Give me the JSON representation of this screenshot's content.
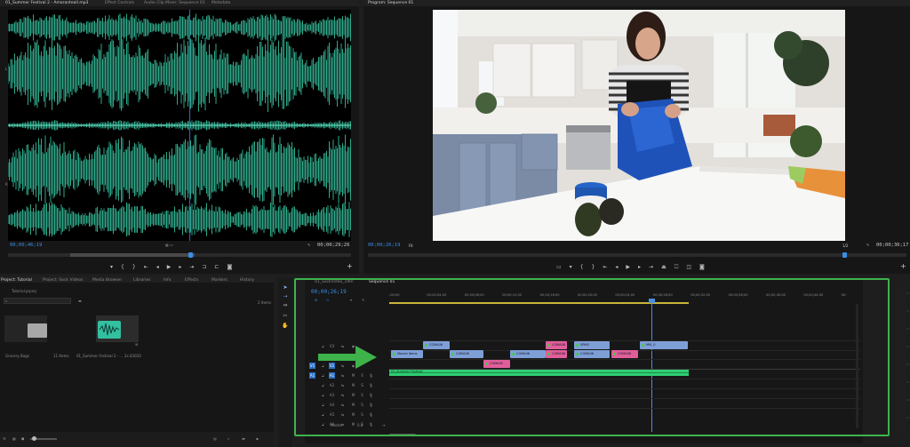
{
  "source": {
    "tabs": [
      "01_Summer Festival 2 - Amaranteall.mp3",
      "Effect Controls",
      "Audio Clip Mixer: Sequence 01",
      "Metadata"
    ],
    "timecode_left": "00;00;46;19",
    "timecode_right": "00;00;29;26",
    "playhead_fraction": 0.53
  },
  "program": {
    "tab": "Program: Sequence 01",
    "timecode_left": "00;00;26;19",
    "fit_label": "Fit",
    "timecode_right": "00;00;30;17",
    "zoom_label": "1/2",
    "playhead_fraction": 0.885
  },
  "project": {
    "tabs": [
      "Project: Tutorial",
      "Project: Sock Videos",
      "Media Browser",
      "Libraries",
      "Info",
      "Effects",
      "Markers",
      "History"
    ],
    "file_name": "Tutorial.prproj",
    "item_count": "2 Items",
    "items": [
      {
        "name": "Grocery Bags",
        "meta": "11 Items"
      },
      {
        "name": "01_Summer Festival 2 - ...",
        "meta": "2s:43033"
      }
    ]
  },
  "timeline": {
    "tabs": [
      "01_SockVideo_19m",
      "Sequence 01"
    ],
    "timecode": "00;00;26;19",
    "ruler": [
      ":00;00",
      "00;00;04;00",
      "00;00;08;00",
      "00;00;12;00",
      "00;00;16;00",
      "00;00;20;00",
      "00;00;24;00",
      "00;00;28;00",
      "00;00;32;00",
      "00;00;36;00",
      "00;00;40;00",
      "00;00;44;00",
      "00;"
    ],
    "tracks": [
      "V3",
      "V2",
      "V1",
      "A1",
      "A2",
      "A3",
      "A4",
      "A5",
      "A6"
    ],
    "master_label": "Master",
    "master_value": "0.0",
    "clips_v2": [
      "CGMA06",
      "CGMA05",
      "CGMA06",
      "SPIN3",
      "CGMA06",
      "MVI_0"
    ],
    "clips_v1": [
      "Moved Items",
      "CGMA06",
      "CGMA06",
      "CGMA06",
      "CGMA06"
    ],
    "audio_clip": "01_Summer Festival"
  },
  "colors": {
    "accent_timecode": "#3a8ee6",
    "waveform": "#2fa78a",
    "clip_blue": "#7e9fd6",
    "clip_pink": "#e05f9a",
    "audio_clip": "#2ecf72",
    "highlight": "#3db34a"
  }
}
